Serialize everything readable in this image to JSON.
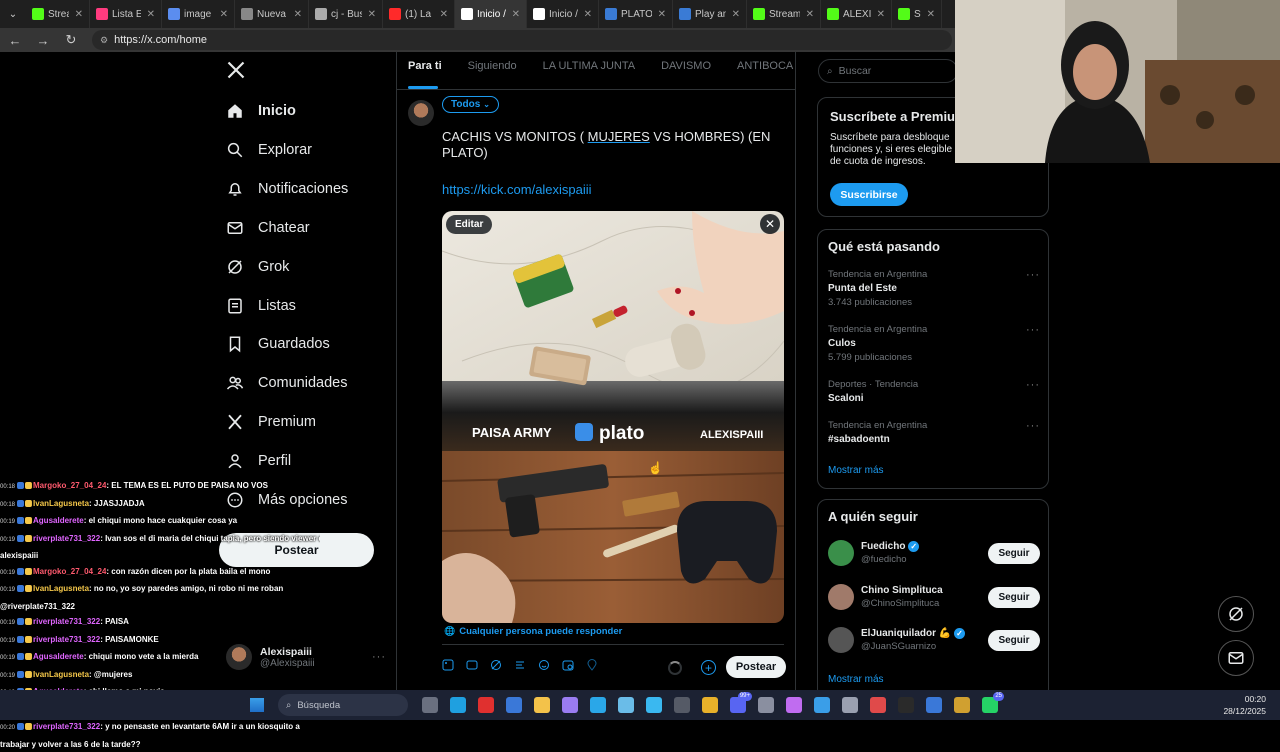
{
  "browser": {
    "tabs": [
      {
        "label": "Stream - K",
        "color": "#53fc18",
        "icon": "kick-icon"
      },
      {
        "label": "Lista Emo",
        "color": "#ff3b7f",
        "icon": "page-icon"
      },
      {
        "label": "image ho",
        "color": "#5b8def",
        "icon": "image-icon"
      },
      {
        "label": "Nueva pe",
        "color": "#888888",
        "icon": "doc-icon"
      },
      {
        "label": "cj - Busca",
        "color": "#aaaaaa",
        "icon": "search-icon"
      },
      {
        "label": "(1) La",
        "color": "#ff2a2a",
        "icon": "youtube-icon"
      },
      {
        "label": "Inicio / X",
        "color": "#ffffff",
        "icon": "x-icon",
        "active": true
      },
      {
        "label": "Inicio / X",
        "color": "#ffffff",
        "icon": "x-icon"
      },
      {
        "label": "PLATO AP",
        "color": "#3a7bd5",
        "icon": "search-icon"
      },
      {
        "label": "Play and e",
        "color": "#3a7bd5",
        "icon": "plato-icon"
      },
      {
        "label": "Stream - K",
        "color": "#53fc18",
        "icon": "kick-icon"
      },
      {
        "label": "ALEXISPA",
        "color": "#53fc18",
        "icon": "kick-icon"
      },
      {
        "label": "Strea",
        "color": "#53fc18",
        "icon": "kick-icon"
      }
    ],
    "url": "https://x.com/home"
  },
  "nav": {
    "items": [
      {
        "label": "Inicio",
        "icon": "home-icon",
        "bold": true
      },
      {
        "label": "Explorar",
        "icon": "search-icon"
      },
      {
        "label": "Notificaciones",
        "icon": "bell-icon"
      },
      {
        "label": "Chatear",
        "icon": "mail-icon"
      },
      {
        "label": "Grok",
        "icon": "grok-icon"
      },
      {
        "label": "Listas",
        "icon": "list-icon"
      },
      {
        "label": "Guardados",
        "icon": "bookmark-icon"
      },
      {
        "label": "Comunidades",
        "icon": "people-icon"
      },
      {
        "label": "Premium",
        "icon": "x-icon"
      },
      {
        "label": "Perfil",
        "icon": "person-icon"
      },
      {
        "label": "Más opciones",
        "icon": "more-icon"
      }
    ],
    "post_label": "Postear",
    "account": {
      "name": "Alexispaiii",
      "handle": "@Alexispaiii"
    }
  },
  "feed": {
    "tabs": [
      "Para ti",
      "Siguiendo",
      "LA ULTIMA JUNTA",
      "DAVISMO",
      "ANTIBOCA PROFESI"
    ],
    "audience": "Todos",
    "post_text_before": "CACHIS VS MONITOS ( ",
    "post_text_underlined": "MUJERES",
    "post_text_after": " VS HOMBRES) (EN PLATO)",
    "post_link": "https://kick.com/alexispaiii",
    "edit_label": "Editar",
    "media_brands": {
      "left": "PAISA ARMY",
      "center": "plato",
      "right": "ALEXISPAIII"
    },
    "reply_setting": "Cualquier persona puede responder",
    "post_button": "Postear"
  },
  "right": {
    "search_placeholder": "Buscar",
    "premium": {
      "title": "Suscríbete a Premiu",
      "desc": "Suscríbete para desbloque funciones y, si eres elegible de cuota de ingresos.",
      "button": "Suscribirse"
    },
    "trends": {
      "title": "Qué está pasando",
      "items": [
        {
          "context": "Tendencia en Argentina",
          "name": "Punta del Este",
          "count": "3.743 publicaciones"
        },
        {
          "context": "Tendencia en Argentina",
          "name": "Culos",
          "count": "5.799 publicaciones"
        },
        {
          "context": "Deportes · Tendencia",
          "name": "Scaloni",
          "count": ""
        },
        {
          "context": "Tendencia en Argentina",
          "name": "#sabadoentn",
          "count": ""
        }
      ],
      "more": "Mostrar más"
    },
    "follow": {
      "title": "A quién seguir",
      "items": [
        {
          "name": "Fuedicho",
          "handle": "@fuedicho",
          "verified": true,
          "avatar_color": "#3a8f4a"
        },
        {
          "name": "Chino Simplituca",
          "handle": "@ChinoSimplituca",
          "verified": false,
          "avatar_color": "#a07a6a"
        },
        {
          "name": "ElJuaniquilador 💪",
          "handle": "@JuanSGuarnizo",
          "verified": true,
          "avatar_color": "#555555"
        }
      ],
      "button": "Seguir",
      "more": "Mostrar más"
    }
  },
  "chat": [
    {
      "time": "00:18",
      "user": "Margoko_27_04_24",
      "color": "red",
      "msg": ": EL TEMA ES EL PUTO DE PAISA NO VOS"
    },
    {
      "time": "00:18",
      "user": "IvanLagusneta",
      "color": "yel",
      "msg": ": JJASJJADJA"
    },
    {
      "time": "00:19",
      "user": "Agusalderete",
      "color": "mag",
      "msg": ": el chiqui mono hace cuakquier cosa ya"
    },
    {
      "time": "00:19",
      "user": "riverplate731_322",
      "color": "mag",
      "msg": ": Ivan sos el di maria del chiqui tapia, pero siendo viewer de"
    },
    {
      "time": "",
      "user": "",
      "color": "",
      "msg": "alexispaiii"
    },
    {
      "time": "00:19",
      "user": "Margoko_27_04_24",
      "color": "red",
      "msg": ": con razón dicen por la plata baila el mono"
    },
    {
      "time": "00:19",
      "user": "IvanLagusneta",
      "color": "yel",
      "msg": ": no no, yo soy paredes amigo, ni robo ni me roban"
    },
    {
      "time": "",
      "user": "",
      "color": "",
      "msg": "@riverplate731_322"
    },
    {
      "time": "00:19",
      "user": "riverplate731_322",
      "color": "mag",
      "msg": ": PAISA"
    },
    {
      "time": "00:19",
      "user": "riverplate731_322",
      "color": "mag",
      "msg": ": PAISAMONKE"
    },
    {
      "time": "00:19",
      "user": "Agusalderete",
      "color": "mag",
      "msg": ": chiqui mono vete a la mierda"
    },
    {
      "time": "00:19",
      "user": "IvanLagusneta",
      "color": "yel",
      "msg": ": @mujeres"
    },
    {
      "time": "00:19",
      "user": "Agusalderete",
      "color": "mag",
      "msg": ": ahi llamo a mi novia"
    },
    {
      "time": "00:19",
      "user": "Margoko_27_04_24",
      "color": "red",
      "msg": ": hagan votaciones para sacar a paisa de presidente"
    },
    {
      "time": "00:20",
      "user": "riverplate731_322",
      "color": "mag",
      "msg": ": y no pensaste en levantarte 6AM ir a un kiosquito a"
    },
    {
      "time": "",
      "user": "",
      "color": "",
      "msg": "trabajar y volver a las 6 de la tarde??"
    }
  ],
  "taskbar": {
    "search_placeholder": "Búsqueda",
    "time": "00:20",
    "date": "28/12/2025",
    "badges": {
      "discord": "99+",
      "whatsapp": "25"
    },
    "icons": [
      {
        "name": "task-view-icon",
        "color": "#6a7080"
      },
      {
        "name": "edge-icon",
        "color": "#1fa0e0"
      },
      {
        "name": "opera-icon",
        "color": "#e0302f"
      },
      {
        "name": "store-icon",
        "color": "#3a78d8"
      },
      {
        "name": "folder-icon",
        "color": "#f3c24a"
      },
      {
        "name": "pen-icon",
        "color": "#9a7cf0"
      },
      {
        "name": "edge-alt-icon",
        "color": "#2aa7e8"
      },
      {
        "name": "refresh-icon",
        "color": "#6abce8"
      },
      {
        "name": "notepad-icon",
        "color": "#3ab8f0"
      },
      {
        "name": "terminal-icon",
        "color": "#555a66"
      },
      {
        "name": "chrome-icon",
        "color": "#e8b12a"
      },
      {
        "name": "discord-icon",
        "color": "#5865f2"
      },
      {
        "name": "settings-icon",
        "color": "#8a8fa0"
      },
      {
        "name": "vs-icon",
        "color": "#c06cf0"
      },
      {
        "name": "snip-icon",
        "color": "#3a9ee8"
      },
      {
        "name": "gear-icon",
        "color": "#9aa0b0"
      },
      {
        "name": "app-icon",
        "color": "#e04a4a"
      },
      {
        "name": "obs-icon",
        "color": "#2a2a2a"
      },
      {
        "name": "shield-icon",
        "color": "#3a78d8"
      },
      {
        "name": "app2-icon",
        "color": "#d0a030"
      },
      {
        "name": "whatsapp-icon",
        "color": "#25d366"
      }
    ]
  }
}
